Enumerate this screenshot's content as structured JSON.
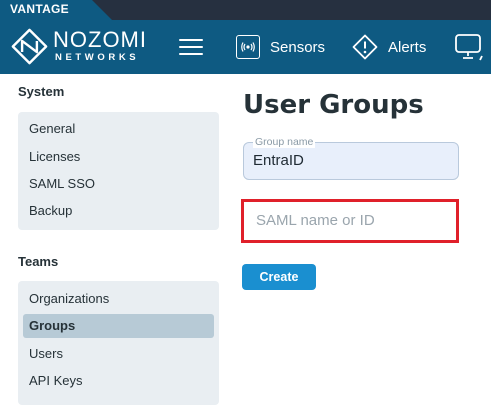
{
  "topbar": {
    "vantage_label": "VANTAGE"
  },
  "header": {
    "logo_text": "NOZOMI",
    "logo_subtext": "NETWORKS",
    "nav": {
      "sensors": "Sensors",
      "alerts": "Alerts"
    }
  },
  "sidebar": {
    "system": {
      "title": "System",
      "items": [
        {
          "label": "General"
        },
        {
          "label": "Licenses"
        },
        {
          "label": "SAML SSO"
        },
        {
          "label": "Backup"
        }
      ]
    },
    "teams": {
      "title": "Teams",
      "items": [
        {
          "label": "Organizations"
        },
        {
          "label": "Groups",
          "active": true
        },
        {
          "label": "Users"
        },
        {
          "label": "API Keys"
        }
      ]
    }
  },
  "main": {
    "title": "User Groups",
    "group_name": {
      "legend": "Group name",
      "value": "EntraID"
    },
    "saml_field": {
      "placeholder": "SAML name or ID"
    },
    "create_label": "Create"
  },
  "colors": {
    "header_bg": "#0e5a82",
    "top_strip_bg": "#263040",
    "sidebar_box_bg": "#e9eef2",
    "active_item_bg": "#b7cad6",
    "create_button_bg": "#1a8fd0",
    "highlight_border": "#e0202a"
  }
}
